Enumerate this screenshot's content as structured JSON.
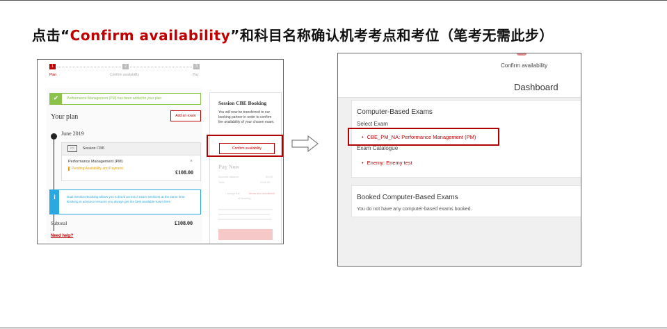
{
  "slide": {
    "headline_prefix": "点击“",
    "headline_highlight": "Confirm availability",
    "headline_suffix": "”和科目名称确认机考考点和考位（笔考无需此步）"
  },
  "left_screenshot": {
    "steps": [
      {
        "number": "1",
        "label": "Plan"
      },
      {
        "number": "2",
        "label": "Confirm availability"
      },
      {
        "number": "3",
        "label": "Pay"
      }
    ],
    "success_message": "Performance Management (PM) has been added to your plan",
    "your_plan_title": "Your plan",
    "add_exam_label": "Add an exam",
    "session_month": "June 2019",
    "session_label": "Session CBE",
    "exam_name": "Performance Management (PM)",
    "remove_label": "×",
    "pending_status": "Pending Availability and Payment",
    "exam_price": "£108.00",
    "info_icon": "i",
    "info_text": "Dual Session Booking allows you to book across 2 exam sessions at the same time. Booking in advance ensures you always get the best available exam fees",
    "subtotal_label": "Subtotal",
    "subtotal_price": "£108.00",
    "need_help": "Need help?",
    "booking_panel": {
      "title": "Session CBE Booking",
      "text": "You will now be transferred to our booking partner in order to confirm the availability of your chosen exam.",
      "confirm_button": "Confirm availability",
      "pay_now": "Pay Now",
      "account_balance_label": "Account balance",
      "account_balance_value": "£0.00",
      "total_label": "Total",
      "total_value": "£108.00",
      "terms_prefix": "I accept the",
      "terms_link": "terms and conditions",
      "terms_suffix": "of booking"
    }
  },
  "right_screenshot": {
    "nav_link": "Confirm availability",
    "page_title": "Dashboard",
    "cbe_card": {
      "title": "Computer-Based Exams",
      "select_exam_label": "Select Exam",
      "exam_link": "CBE_PM_NA: Performance Management (PM)",
      "catalogue_label": "Exam Catalogue",
      "catalogue_link": "Enemy: Enemy test"
    },
    "booked_card": {
      "title": "Booked Computer-Based Exams",
      "empty_text": "You do not have any computer-based exams booked."
    }
  },
  "colors": {
    "accent_red": "#c00000",
    "success_green": "#8bc34a",
    "info_blue": "#29a9e0",
    "pending_orange": "#e8a000"
  }
}
